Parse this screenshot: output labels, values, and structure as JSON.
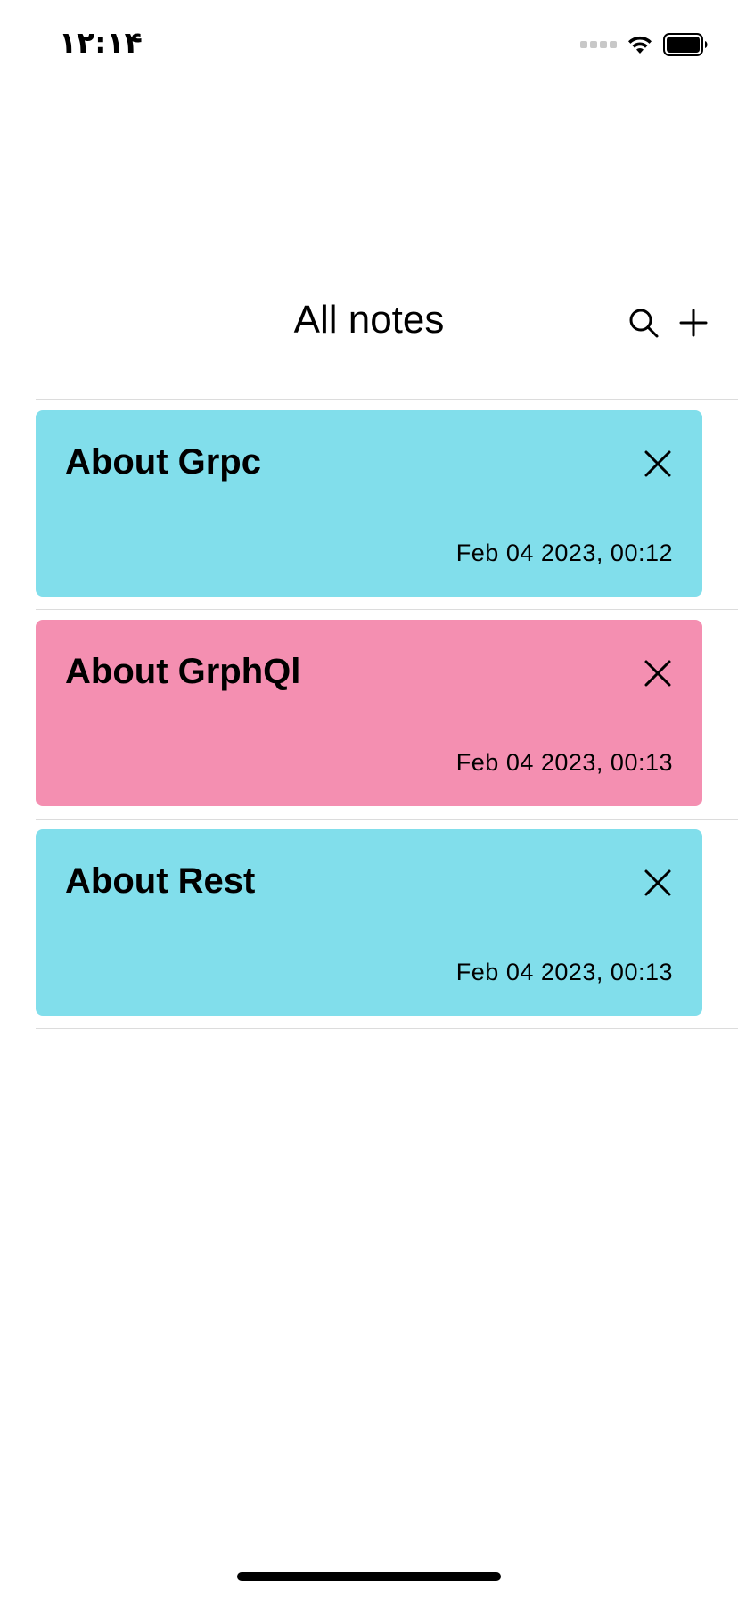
{
  "status_bar": {
    "time": "۱۲:۱۴",
    "icons": [
      "cellular-signal-icon",
      "wifi-icon",
      "battery-icon"
    ]
  },
  "header": {
    "title": "All notes",
    "actions": [
      {
        "icon": "search-icon"
      },
      {
        "icon": "plus-icon"
      }
    ]
  },
  "notes": [
    {
      "title": "About Grpc",
      "date": "Feb 04 2023, 00:12",
      "color": "#81DEEB",
      "delete_icon": "close-icon"
    },
    {
      "title": "About GrphQl",
      "date": "Feb 04 2023, 00:13",
      "color": "#F48FB1",
      "delete_icon": "close-icon"
    },
    {
      "title": "About Rest",
      "date": "Feb 04 2023, 00:13",
      "color": "#81DEEB",
      "delete_icon": "close-icon"
    }
  ],
  "colors": {
    "background": "#FFFFFF",
    "divider": "#DCDCDC",
    "text": "#000000"
  }
}
